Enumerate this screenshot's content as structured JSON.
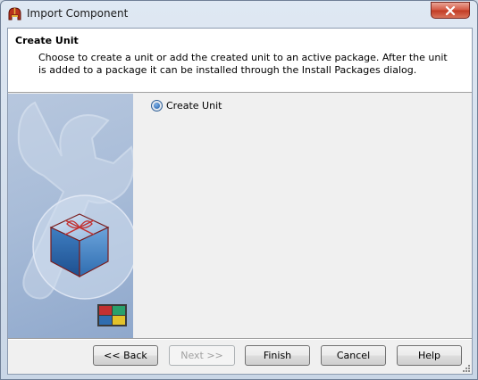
{
  "window": {
    "title": "Import Component",
    "icon": "helmet-app-icon"
  },
  "header": {
    "title": "Create Unit",
    "description": "Choose to create a unit or add the created unit to an active package. After the unit is added to a package it can be installed through the Install Packages dialog."
  },
  "options": {
    "create_unit_label": "Create Unit",
    "create_unit_selected": true
  },
  "buttons": {
    "back": "<< Back",
    "next": "Next >>",
    "finish": "Finish",
    "cancel": "Cancel",
    "help": "Help"
  },
  "colors": {
    "accent": "#2c5d95",
    "close_red": "#c13a22"
  }
}
